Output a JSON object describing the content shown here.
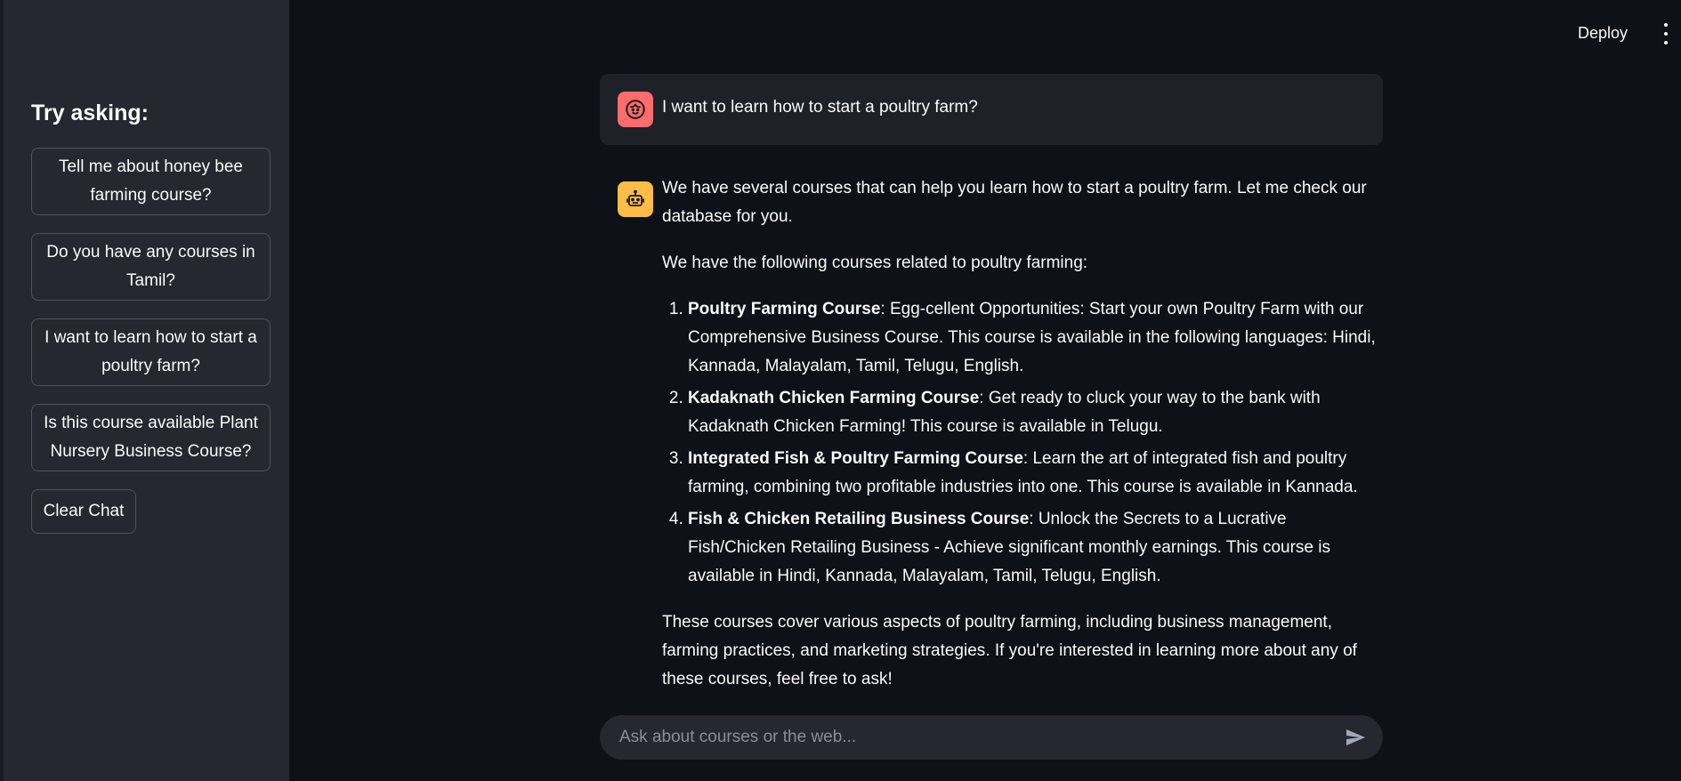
{
  "sidebar": {
    "title": "Try asking:",
    "suggestions": [
      "Tell me about honey bee farming course?",
      "Do you have any courses in Tamil?",
      "I want to learn how to start a poultry farm?",
      "Is this course available Plant Nursery Business Course?"
    ],
    "clear_label": "Clear Chat"
  },
  "header": {
    "deploy_label": "Deploy",
    "menu_icon": "kebab-menu-icon"
  },
  "chat": {
    "user_message": "I want to learn how to start a poultry farm?",
    "user_avatar_color": "#ff6c6c",
    "bot_avatar_color": "#ffbd45",
    "bot_intro": "We have several courses that can help you learn how to start a poultry farm. Let me check our database for you.",
    "bot_list_intro": "We have the following courses related to poultry farming:",
    "courses": [
      {
        "name": "Poultry Farming Course",
        "desc": ": Egg-cellent Opportunities: Start your own Poultry Farm with our Comprehensive Business Course. This course is available in the following languages: Hindi, Kannada, Malayalam, Tamil, Telugu, English."
      },
      {
        "name": "Kadaknath Chicken Farming Course",
        "desc": ": Get ready to cluck your way to the bank with Kadaknath Chicken Farming! This course is available in Telugu."
      },
      {
        "name": "Integrated Fish & Poultry Farming Course",
        "desc": ": Learn the art of integrated fish and poultry farming, combining two profitable industries into one. This course is available in Kannada."
      },
      {
        "name": "Fish & Chicken Retailing Business Course",
        "desc": ": Unlock the Secrets to a Lucrative Fish/Chicken Retailing Business - Achieve significant monthly earnings. This course is available in Hindi, Kannada, Malayalam, Tamil, Telugu, English."
      }
    ],
    "bot_outro": "These courses cover various aspects of poultry farming, including business management, farming practices, and marketing strategies. If you're interested in learning more about any of these courses, feel free to ask!"
  },
  "input": {
    "placeholder": "Ask about courses or the web...",
    "value": ""
  }
}
